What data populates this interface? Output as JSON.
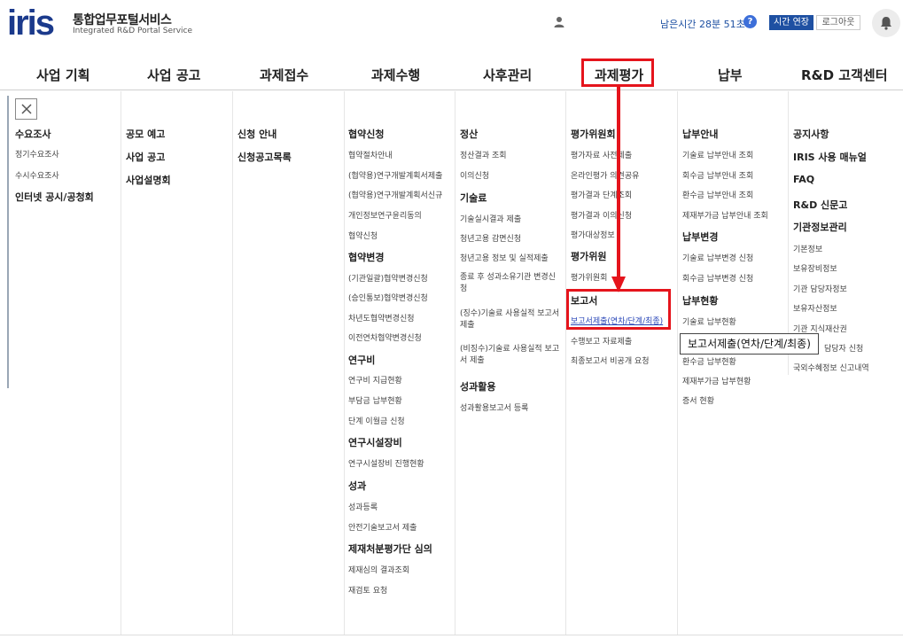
{
  "header": {
    "logo": "iris",
    "title": "통합업무포털서비스",
    "subtitle": "Integrated R&D Portal Service",
    "timer": "남은시간 28분 51초",
    "help": "?",
    "extend_label": "시간 연장",
    "logout_label": "로그아웃"
  },
  "nav": [
    "사업 기획",
    "사업 공고",
    "과제접수",
    "과제수행",
    "사후관리",
    "과제평가",
    "납부",
    "R&D 고객센터"
  ],
  "menu": {
    "col1": {
      "h1": "수요조사",
      "s1": "정기수요조사",
      "s2": "수시수요조사",
      "h2": "인터넷 공시/공청회"
    },
    "col2": {
      "h1": "공모 예고",
      "h2": "사업 공고",
      "h3": "사업설명회"
    },
    "col3": {
      "h1": "신청 안내",
      "h2": "신청공고목록"
    },
    "col4": {
      "h1": "협약신청",
      "s1": "협약절차안내",
      "s2": "(협약용)연구개발계획서제출",
      "s3": "(협약용)연구개발계획서신규",
      "s4": "개인정보연구윤리동의",
      "s5": "협약신청",
      "h2": "협약변경",
      "s6": "(기관일괄)협약변경신청",
      "s7": "(승인통보)협약변경신청",
      "s8": "차년도협약변경신청",
      "s9": "이전연차협약변경신청",
      "h3": "연구비",
      "s10": "연구비 지급현황",
      "s11": "부담금 납부현황",
      "s12": "단계 이월금 신청",
      "h4": "연구시설장비",
      "s13": "연구시설장비 진행현황",
      "h5": "성과",
      "s14": "성과등록",
      "s15": "안전기술보고서 제출",
      "h6": "제재처분평가단 심의",
      "s16": "제재심의 결과조회",
      "s17": "재검토 요청"
    },
    "col5": {
      "h1": "정산",
      "s1": "정산결과 조회",
      "s2": "이의신청",
      "h2": "기술료",
      "s3": "기술실시결과 제출",
      "s4": "청년고용 감면신청",
      "s5": "청년고용 정보 및 실적제출",
      "s6": "종료 후 성과소유기관 변경신청",
      "s7": "(징수)기술료 사용실적 보고서 제출",
      "s8": "(비징수)기술료 사용실적 보고서 제출",
      "h3": "성과활용",
      "s9": "성과활용보고서 등록"
    },
    "col6": {
      "h1": "평가위원회",
      "s1": "평가자료 사전제출",
      "s2": "온라인평가 의견공유",
      "s3": "평가결과 단계조회",
      "s4": "평가결과 이의신청",
      "s5": "평가대상정보",
      "h2": "평가위원",
      "s6": "평가위원회",
      "h3": "보고서",
      "s7": "보고서제출(연차/단계/최종)",
      "s8": "수행보고 자료제출",
      "s9": "최종보고서 비공개 요청"
    },
    "col7": {
      "h1": "납부안내",
      "s1": "기술료 납부안내 조회",
      "s2": "회수금 납부안내 조회",
      "s3": "환수금 납부안내 조회",
      "s4": "제재부가금 납부안내 조회",
      "h2": "납부변경",
      "s5": "기술료 납부변경 신청",
      "s6": "회수금 납부변경 신청",
      "h3": "납부현황",
      "s7": "기술료 납부현황",
      "s8": "환수금 납부현황",
      "s9": "제재부가금 납부현황",
      "s10": "증서 현황"
    },
    "col8": {
      "h1": "공지사항",
      "h2": "IRIS 사용 매뉴얼",
      "h3": "FAQ",
      "h4": "R&D 신문고",
      "h5": "기관정보관리",
      "s1": "기본정보",
      "s2": "보유장비정보",
      "s3": "기관 담당자정보",
      "s4": "보유자산정보",
      "s5": "기관 지식재산권",
      "s6": "담당자 신청",
      "s7": "국외수혜정보 신고내역"
    }
  },
  "tooltip": "보고서제출(연차/단계/최종)",
  "colors": {
    "brand": "#1b3a8c",
    "highlight": "#e5141c",
    "accent": "#1e50a2"
  }
}
